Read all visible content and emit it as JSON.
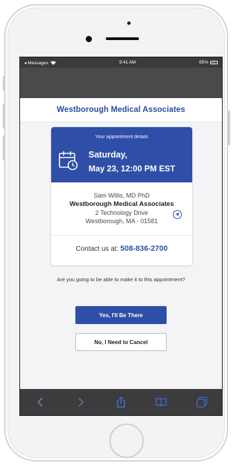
{
  "status_bar": {
    "back_app": "◂ Messages",
    "time": "9:41 AM",
    "battery": "85%"
  },
  "header": {
    "title": "Westborough Medical Associates"
  },
  "appointment": {
    "subtitle": "Your appointment details",
    "day": "Saturday,",
    "datetime": "May 23, 12:00 PM EST",
    "provider": "Sam Willis, MD PhD",
    "clinic": "Westborough Medical Associates",
    "street": "2 Technology Drive",
    "city": "Westborough, MA - 01581",
    "contact_prefix": "Contact us at:",
    "contact_phone": "508-836-2700"
  },
  "prompt": {
    "question": "Are you going to be able to make it to this appointment?"
  },
  "actions": {
    "confirm_label": "Yes, I'll Be There",
    "cancel_label": "No, I Need to Cancel"
  },
  "toolbar": {
    "icons": [
      "back-icon",
      "forward-icon",
      "share-icon",
      "bookmarks-icon",
      "tabs-icon"
    ]
  },
  "colors": {
    "accent": "#2f4ea7",
    "status_bar": "#3a3a3c",
    "toolbar": "#3c3c3e"
  }
}
